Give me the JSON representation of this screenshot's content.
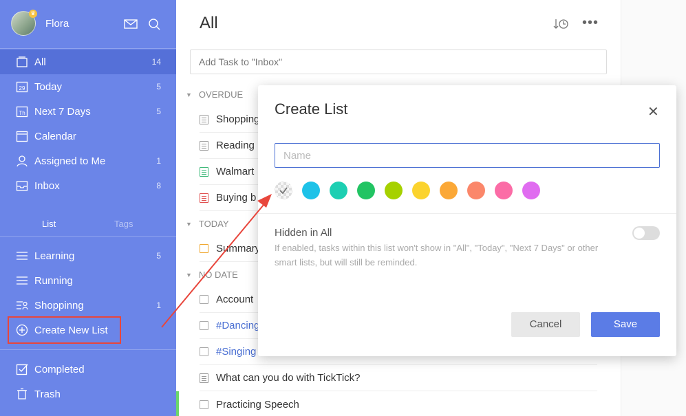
{
  "profile": {
    "username": "Flora"
  },
  "nav": [
    {
      "label": "All",
      "count": "14",
      "icon": "all-icon",
      "active": true
    },
    {
      "label": "Today",
      "count": "5",
      "icon": "calendar-day-icon",
      "day": "29"
    },
    {
      "label": "Next 7 Days",
      "count": "5",
      "icon": "calendar-week-icon",
      "day": "Th"
    },
    {
      "label": "Calendar",
      "count": "",
      "icon": "calendar-icon"
    },
    {
      "label": "Assigned to Me",
      "count": "1",
      "icon": "person-icon"
    },
    {
      "label": "Inbox",
      "count": "8",
      "icon": "inbox-icon"
    }
  ],
  "section_tabs": {
    "list": "List",
    "tags": "Tags"
  },
  "lists": [
    {
      "label": "Learning",
      "count": "5",
      "icon": "list-icon"
    },
    {
      "label": "Running",
      "count": "",
      "icon": "list-icon"
    },
    {
      "label": "Shoppinng",
      "count": "1",
      "icon": "shared-list-icon"
    }
  ],
  "create_list_label": "Create New List",
  "bottom_nav": [
    {
      "label": "Completed",
      "icon": "check-square-icon"
    },
    {
      "label": "Trash",
      "icon": "trash-icon"
    }
  ],
  "main": {
    "title": "All",
    "add_task_placeholder": "Add Task to \"Inbox\"",
    "groups": [
      {
        "label": "OVERDUE"
      },
      {
        "label": "TODAY"
      },
      {
        "label": "NO DATE"
      }
    ],
    "tasks": [
      {
        "text": "Shopping",
        "kind": "note",
        "color": "#999999"
      },
      {
        "text": "Reading",
        "kind": "note",
        "color": "#999999"
      },
      {
        "text": "Walmart",
        "kind": "note",
        "color": "#3cb878"
      },
      {
        "text": "Buying b",
        "kind": "note",
        "color": "#e05252"
      },
      {
        "text": "Summary",
        "kind": "checkbox",
        "color": "#f0a830"
      },
      {
        "text": "Account",
        "kind": "checkbox",
        "color": "#aaaaaa"
      },
      {
        "text": "#Dancing",
        "kind": "checkbox",
        "color": "#aaaaaa",
        "tag": true
      },
      {
        "text": "#Singing",
        "kind": "checkbox",
        "color": "#aaaaaa",
        "tag": true
      },
      {
        "text": "What can you do with TickTick?",
        "kind": "note",
        "color": "#999999"
      },
      {
        "text": "Practicing Speech",
        "kind": "checkbox",
        "color": "#aaaaaa"
      }
    ]
  },
  "dialog": {
    "title": "Create List",
    "name_placeholder": "Name",
    "colors": [
      "#1ec2e8",
      "#1dcfb2",
      "#22c463",
      "#a6d100",
      "#fbd32e",
      "#fba837",
      "#fb876a",
      "#fb6ca6",
      "#e06cf0"
    ],
    "hidden_label": "Hidden in All",
    "hidden_description": "If enabled, tasks within this list won't show in \"All\", \"Today\", \"Next 7 Days\" or other smart lists, but will still be reminded.",
    "cancel_label": "Cancel",
    "save_label": "Save"
  },
  "colors": {
    "sidebar": "#6b85e8",
    "accent": "#5b7ce6",
    "annotation": "#e8463c"
  }
}
